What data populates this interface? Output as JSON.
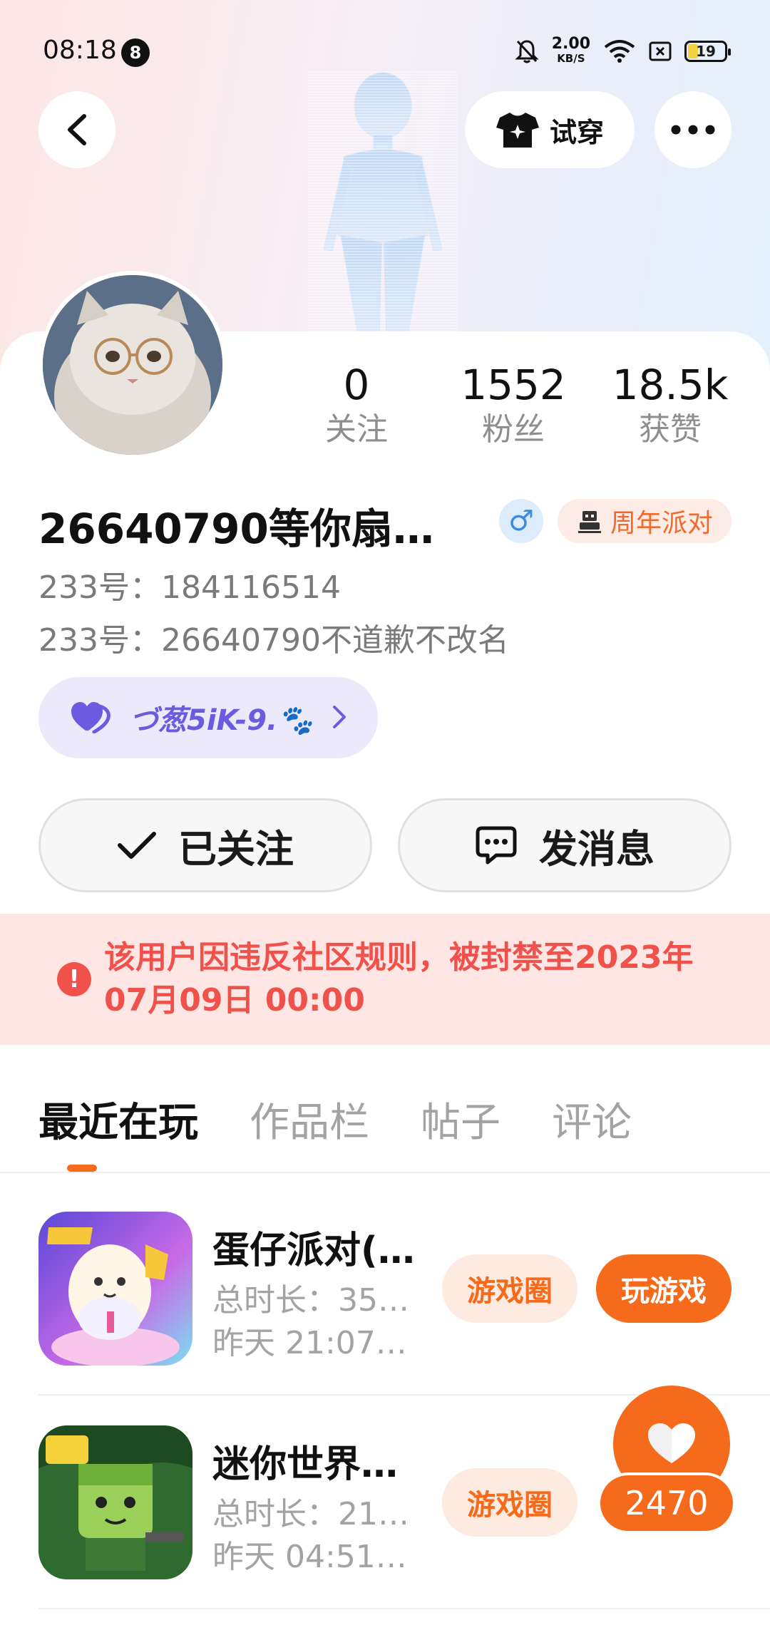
{
  "status_bar": {
    "time": "08:18",
    "notification_count": "8",
    "net_speed": "2.00",
    "net_unit": "KB/S",
    "battery": "19"
  },
  "header": {
    "try_on_label": "试穿"
  },
  "profile": {
    "stats": [
      {
        "value": "0",
        "label": "关注"
      },
      {
        "value": "1552",
        "label": "粉丝"
      },
      {
        "value": "18.5k",
        "label": "获赞"
      }
    ],
    "username": "26640790等你扇飞…",
    "gender_symbol": "♂",
    "party_badge": "周年派对",
    "id_label_1": "233号：",
    "id_value_1": "184116514",
    "id_label_2": "233号：",
    "id_value_2": "26640790不道歉不改名",
    "nickname_tag": "づ葱5iK-9.🐾"
  },
  "actions": {
    "follow_label": "已关注",
    "message_label": "发消息"
  },
  "ban_notice": {
    "text": "该用户因违反社区规则，被封禁至2023年07月09日 00:00"
  },
  "tabs": [
    {
      "label": "最近在玩",
      "active": true
    },
    {
      "label": "作品栏",
      "active": false
    },
    {
      "label": "帖子",
      "active": false
    },
    {
      "label": "评论",
      "active": false
    }
  ],
  "games": [
    {
      "title": "蛋仔派对(…",
      "duration": "总时长：35…",
      "last_played": "昨天 21:07…",
      "circle_label": "游戏圈",
      "play_label": "玩游戏"
    },
    {
      "title": "迷你世界…",
      "duration": "总时长：21…",
      "last_played": "昨天 04:51…",
      "circle_label": "游戏圈"
    }
  ],
  "like_fab": {
    "count": "2470"
  },
  "colors": {
    "accent": "#f56a1b",
    "ban_text": "#f0514a",
    "ban_bg": "#fde6e4",
    "nickname": "#6c5be0"
  }
}
